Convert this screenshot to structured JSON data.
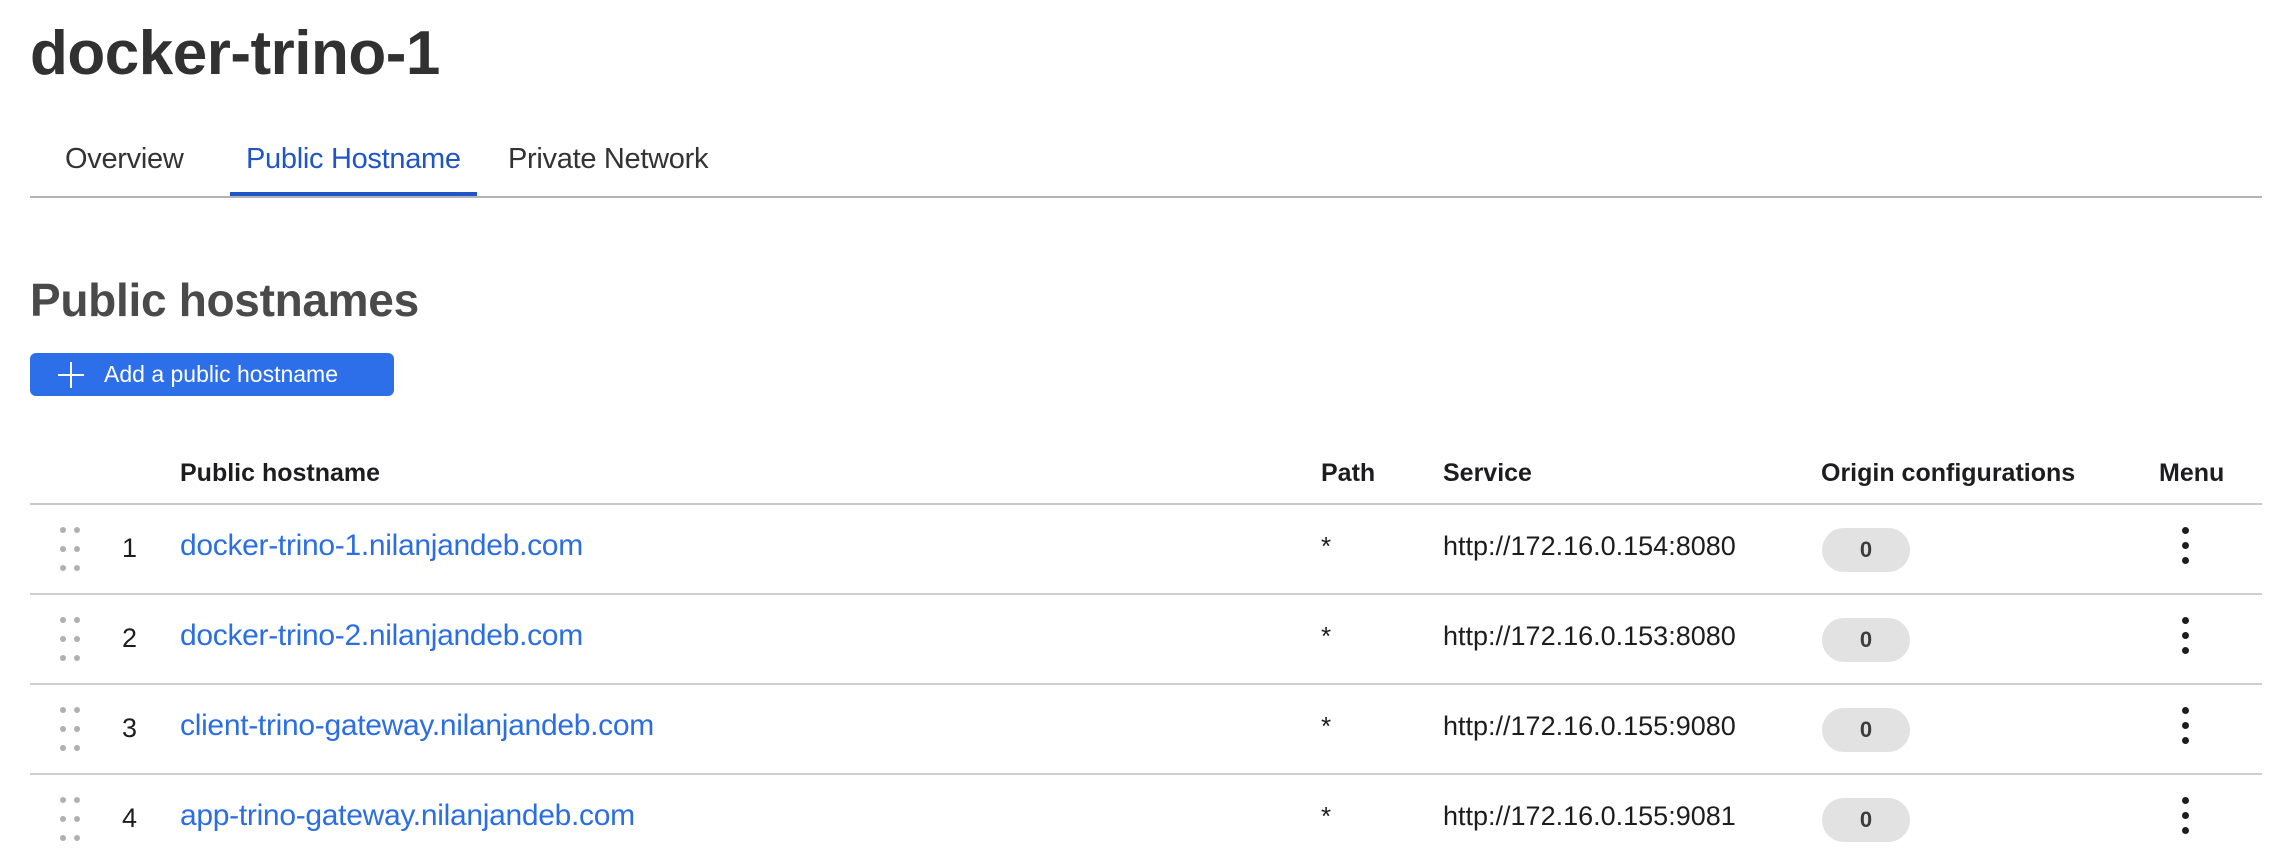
{
  "page": {
    "title": "docker-trino-1"
  },
  "tabs": [
    {
      "label": "Overview",
      "active": false
    },
    {
      "label": "Public Hostname",
      "active": true
    },
    {
      "label": "Private Network",
      "active": false
    }
  ],
  "section": {
    "title": "Public hostnames",
    "add_button_label": "Add a public hostname",
    "add_button_icon": "plus-icon"
  },
  "table": {
    "columns": {
      "hostname": "Public hostname",
      "path": "Path",
      "service": "Service",
      "origin": "Origin configurations",
      "menu": "Menu"
    },
    "rows": [
      {
        "num": "1",
        "hostname": "docker-trino-1.nilanjandeb.com",
        "path": "*",
        "service": "http://172.16.0.154:8080",
        "origin": "0"
      },
      {
        "num": "2",
        "hostname": "docker-trino-2.nilanjandeb.com",
        "path": "*",
        "service": "http://172.16.0.153:8080",
        "origin": "0"
      },
      {
        "num": "3",
        "hostname": "client-trino-gateway.nilanjandeb.com",
        "path": "*",
        "service": "http://172.16.0.155:9080",
        "origin": "0"
      },
      {
        "num": "4",
        "hostname": "app-trino-gateway.nilanjandeb.com",
        "path": "*",
        "service": "http://172.16.0.155:9081",
        "origin": "0"
      }
    ]
  },
  "colors": {
    "accent": "#2c6fe8",
    "active_tab": "#1f55c6",
    "link": "#2b6ee2",
    "badge_bg": "#e2e2e2"
  }
}
